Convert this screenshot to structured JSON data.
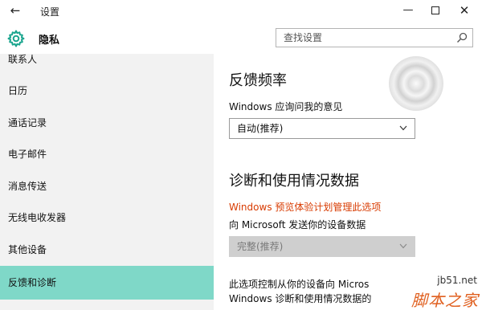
{
  "window": {
    "title": "设置",
    "back_glyph": "←",
    "minimize_glyph": "—",
    "close_glyph": "✕"
  },
  "header": {
    "section_title": "隐私",
    "icon": "gear-icon",
    "search": {
      "placeholder": "查找设置",
      "value": ""
    }
  },
  "sidebar": {
    "items": [
      {
        "label": "联系人"
      },
      {
        "label": "日历"
      },
      {
        "label": "通话记录"
      },
      {
        "label": "电子邮件"
      },
      {
        "label": "消息传送"
      },
      {
        "label": "无线电收发器"
      },
      {
        "label": "其他设备"
      },
      {
        "label": "反馈和诊断",
        "active": true
      }
    ],
    "active_color": "#7fd8c8"
  },
  "main": {
    "feedback": {
      "heading": "反馈频率",
      "prompt": "Windows 应询问我的意见",
      "select_value": "自动(推荐)"
    },
    "diagnostics": {
      "heading": "诊断和使用情况数据",
      "warning": "Windows 预览体验计划管理此选项",
      "prompt": "向 Microsoft 发送你的设备数据",
      "select_value": "完整(推荐)",
      "para_line1": "此选项控制从你的设备向 Micros",
      "para_line2": "Windows 诊断和使用情况数据的"
    },
    "warning_color": "#d83b01"
  },
  "watermark": {
    "url": "jb51.net",
    "text": "脚本之家"
  }
}
